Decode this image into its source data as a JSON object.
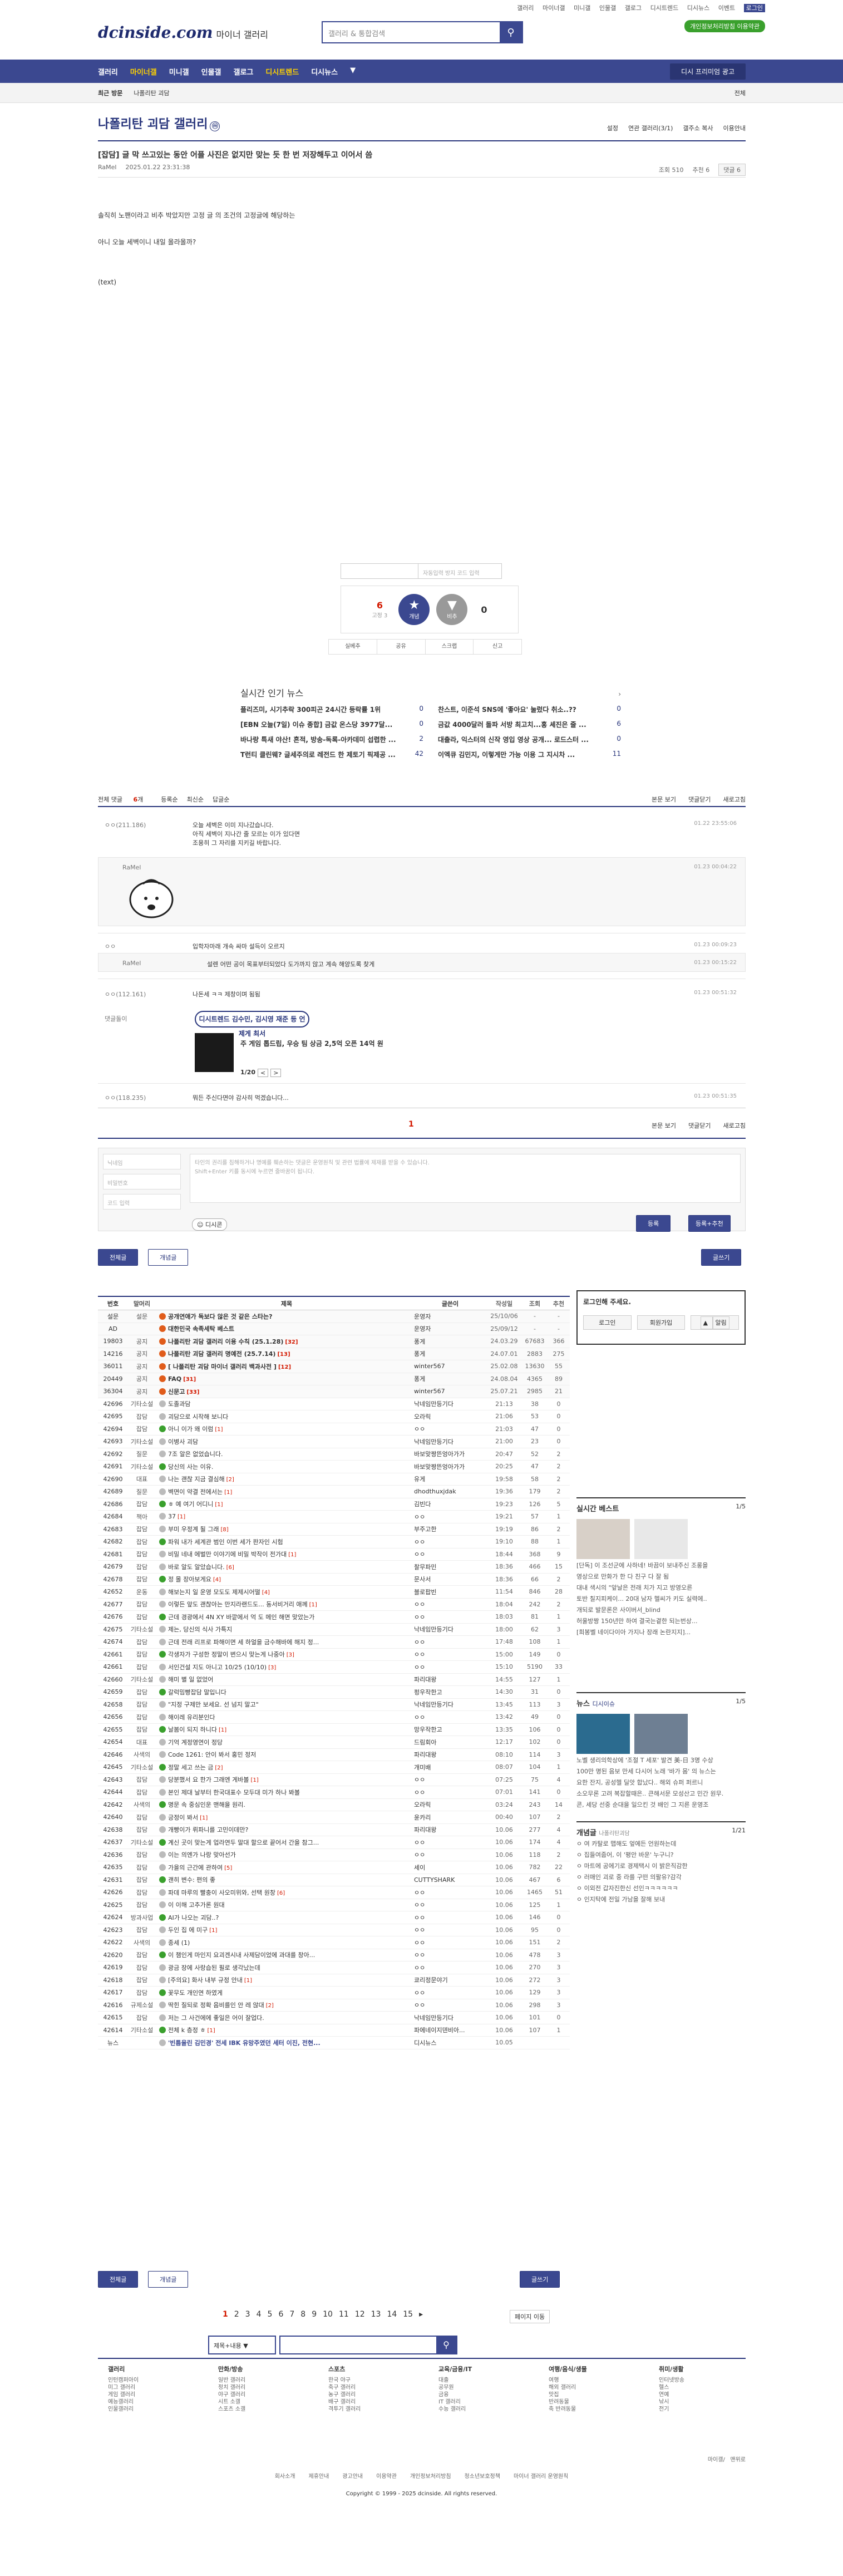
{
  "top": {
    "links": [
      "갤러리",
      "마이너갤",
      "미니갤",
      "인물갤",
      "갤로그",
      "디시트렌드",
      "디시뉴스",
      "이벤트"
    ],
    "login": "로그인",
    "join_btn": "개인정보처리방침 이용약관"
  },
  "logo": {
    "main": "dcinside.com",
    "sub": "마이너 갤러리"
  },
  "search": {
    "placeholder": "갤러리 & 통합검색"
  },
  "gnb": {
    "items": [
      "갤러리",
      "마이너갤",
      "미니갤",
      "인물갤",
      "갤로그",
      "디시트렌드",
      "디시뉴스",
      "디시게임",
      "디시위키"
    ],
    "right": "디시 프리미엄 광고"
  },
  "subbar": {
    "recent": "최근 방문",
    "item": "나폴리탄 괴담",
    "all": "전체"
  },
  "gallery": {
    "title": "나폴리탄 괴담 갤러리",
    "badge": "ⓜ",
    "tools": [
      "설정",
      "연관 갤러리(3/1)",
      "갤주소 복사",
      "이용안내"
    ]
  },
  "post": {
    "head": "[잡담]",
    "title": "글 막 쓰고있는 동안 어플 사진은 없지만 맞는 듯 한 번 저장해두고 이어서 씀",
    "author": "RaMel",
    "date": "2025.01.22 23:31:38",
    "views": "조회 510",
    "recommend": "추천 6",
    "comments": "댓글 6",
    "lines": [
      "솔직히 노팬이라고 비추 박았지만 고정 글 의 조건의 고정글에 해당하는",
      "아니 오늘 세벽이니 내일 올라올까?",
      "(text)"
    ]
  },
  "captcha": {
    "placeholder": "자동입력 방지 코드 입력"
  },
  "vote": {
    "up": "6",
    "up_sub": "고정 3",
    "up_label": "개념",
    "down_label": "비추",
    "down": "0"
  },
  "actions": [
    "실베추",
    "공유",
    "스크랩",
    "신고"
  ],
  "news": {
    "title": "실시간 인기 뉴스",
    "items": [
      {
        "t": "플리즈미, 시기추락 300피곤 24시간 등락률 1위",
        "c": "0"
      },
      {
        "t": "찬스트, 이준석 SNS에 '좋아요' 눌렀다 취소..??",
        "c": "0"
      },
      {
        "t": "[EBN 오늘(7일) 이슈 종합] 금값 온스당 3977달...",
        "c": "0"
      },
      {
        "t": "금값 4000달러 돌파 서방 최고치...홍 셰진은 줄 ...",
        "c": "6"
      },
      {
        "t": "바나랑 특새 야산! 흔적, 방송-독록-아카데미 섭렵한 ...",
        "c": "2"
      },
      {
        "t": "대출라, 익스터의 신작 영입 영상 공개... 로드스터 ...",
        "c": "0"
      },
      {
        "t": "T런티 클린웨? 글세주의로 레전드 한 제토기 픽제공 ...",
        "c": "42"
      },
      {
        "t": "이엑큐 김민지, 이렇게만 가능 이용 그 지시차 ...",
        "c": "11"
      }
    ]
  },
  "cmt_head": {
    "total": "전체 댓글",
    "count": "6",
    "unit": "개",
    "sort": [
      "등록순",
      "최신순",
      "답글순"
    ],
    "right": [
      "본문 보기",
      "댓글닫기",
      "새로고침"
    ]
  },
  "comments": [
    {
      "nick": "ㅇㅇ(211.186)",
      "text": "오늘 세벽은 이미 지나갔습니다.",
      "text2": "아직 세벽이 지나간 줄 모르는 이가 있다면",
      "text3": "조용히 그 자리를 지키길 바랍니다.",
      "time": "01.22 23:55:06"
    },
    {
      "nick": "RaMel",
      "text": "",
      "time": "01.23 00:04:22"
    },
    {
      "nick": "ㅇㅇ",
      "text": "입학자마래 개속 싸마 설득이 오르지",
      "time": "01.23 00:09:23"
    },
    {
      "nick": "RaMel",
      "text": "설렌 어떤 공이 목표부터되었다 도가까지 않고 계속 해양도록 찾게",
      "time": "01.23 00:15:22"
    },
    {
      "nick": "ㅇㅇ(112.161)",
      "text": "나돈세 ㅋㅋ 제창이며 됨됨",
      "time": "01.23 00:51:32"
    },
    {
      "nick": "댓글돌이",
      "text": "디시트렌드 김수민, 금지령 해준 등 언제게 하려",
      "time": ""
    },
    {
      "nick": "ㅇㅇ(118.235)",
      "text": "뭐든 주신다면야 감사히 먹겠습니다...",
      "time": "01.23 00:51:35"
    }
  ],
  "ad_reply": {
    "badge": "디시트렌드 김수민, 김시영 재준 등 언제게 최서",
    "text": "주 게임 톱드립, 우승 팀 상금 2,5억 오픈 14억 원",
    "pages": [
      "1/20",
      "<",
      ">"
    ]
  },
  "cmt_page": "1",
  "cmt_write": {
    "nick_ph": "닉네임",
    "pw_ph": "비밀번호",
    "code_ph": "코드 입력",
    "ta_ph": "타인의 권리를 침해하거나 명예를 훼손하는 댓글은 운영원칙 및 관련 법률에 제재를 받을 수 있습니다.",
    "ta_ph2": "Shift+Enter 키를 동시에 누르면 줄바꿈이 됩니다.",
    "dccon": "디시콘",
    "submit": "등록",
    "submit2": "등록+추천"
  },
  "list_buttons": {
    "all": "전체글",
    "recommend": "개념글",
    "write": "글쓰기"
  },
  "list": {
    "headers": [
      "번호",
      "말머리",
      "제목",
      "글쓴이",
      "작성일",
      "조회",
      "추천"
    ],
    "rows": [
      {
        "no": "설문",
        "h": "설문",
        "t": "공개연애가 독보다 않은 것 같은 스타는?",
        "w": "운영자",
        "d": "25/10/06",
        "c": "-",
        "r": "-",
        "n": 1
      },
      {
        "no": "AD",
        "h": "",
        "t": "대한민국 속족세탁 베스트",
        "w": "운영자",
        "d": "25/09/12",
        "c": "-",
        "r": "-",
        "n": 1
      },
      {
        "no": "19803",
        "h": "공지",
        "t": "나폴리탄 괴담 갤러리 이용 수칙 (25.1.28)",
        "w": "퐁게",
        "d": "24.03.29",
        "c": "67683",
        "r": "366",
        "n": 1,
        "m": "[32]"
      },
      {
        "no": "14216",
        "h": "공지",
        "t": "나폴리탄 괴담 갤러리 명예전 (25.7.14)",
        "w": "퐁게",
        "d": "24.07.01",
        "c": "2883",
        "r": "275",
        "n": 1,
        "m": "[13]"
      },
      {
        "no": "36011",
        "h": "공지",
        "t": "[ 나폴리탄 괴담 마이너 갤러리 백과사전 ]",
        "w": "winter567",
        "d": "25.02.08",
        "c": "13630",
        "r": "55",
        "n": 1,
        "m": "[12]"
      },
      {
        "no": "20449",
        "h": "공지",
        "t": "FAQ",
        "w": "퐁게",
        "d": "24.08.04",
        "c": "4365",
        "r": "89",
        "n": 1,
        "m": "[31]"
      },
      {
        "no": "36304",
        "h": "공지",
        "t": "신문고",
        "w": "winter567",
        "d": "25.07.21",
        "c": "2985",
        "r": "21",
        "n": 1,
        "m": "[33]"
      },
      {
        "no": "42696",
        "h": "기타소설",
        "t": "도졸과담",
        "w": "낙네임만등기다",
        "d": "21:13",
        "c": "38",
        "r": "0"
      },
      {
        "no": "42695",
        "h": "잡담",
        "t": "괴담으로 시작해 보니다",
        "w": "오라릭",
        "d": "21:06",
        "c": "53",
        "r": "0"
      },
      {
        "no": "42694",
        "h": "잡담",
        "t": "아니 이가 왜 이럼",
        "w": "ㅇㅇ",
        "d": "21:03",
        "c": "47",
        "r": "0",
        "m": "[1]"
      },
      {
        "no": "42693",
        "h": "기타소설",
        "t": "이병사 괴담",
        "w": "낙네임만등기다",
        "d": "21:00",
        "c": "23",
        "r": "0"
      },
      {
        "no": "42692",
        "h": "질문",
        "t": "7조 알은 없었습니다.",
        "w": "바보맞짱뜬엉아가가",
        "d": "20:47",
        "c": "52",
        "r": "2"
      },
      {
        "no": "42691",
        "h": "기타소설",
        "t": "당신의 사는 이유.",
        "w": "바보맞짱뜬엉아가가",
        "d": "20:25",
        "c": "47",
        "r": "2"
      },
      {
        "no": "42690",
        "h": "대표",
        "t": "나는 괜찮 지금 결심해",
        "w": "유게",
        "d": "19:58",
        "c": "58",
        "r": "2",
        "m": "[2]"
      },
      {
        "no": "42689",
        "h": "질문",
        "t": "벽면이 약결 전에서는",
        "w": "dhodthuxjdak",
        "d": "19:36",
        "c": "179",
        "r": "2",
        "m": "[1]"
      },
      {
        "no": "42686",
        "h": "잡담",
        "t": "ㅎ 예 여기 어디니",
        "w": "김빈다",
        "d": "19:23",
        "c": "126",
        "r": "5",
        "m": "[1]"
      },
      {
        "no": "42684",
        "h": "책아",
        "t": "37",
        "w": "ㅇㅇ",
        "d": "19:21",
        "c": "57",
        "r": "1",
        "m": "[1]"
      },
      {
        "no": "42683",
        "h": "잡담",
        "t": "부미 우정계 될 그래",
        "w": "부주고한",
        "d": "19:19",
        "c": "86",
        "r": "2",
        "m": "[8]"
      },
      {
        "no": "42682",
        "h": "잡담",
        "t": "파워 내가 세계관 범인 이번 세가 판자인 시험",
        "w": "ㅇㅇ",
        "d": "19:10",
        "c": "88",
        "r": "1"
      },
      {
        "no": "42681",
        "h": "잡담",
        "t": "비밀 네내 에벌만 이야기에 비밀 박작이 전가대",
        "w": "ㅇㅇ",
        "d": "18:44",
        "c": "368",
        "r": "9",
        "m": "[1]"
      },
      {
        "no": "42679",
        "h": "잡담",
        "t": "바로 알도 알았습니다.",
        "w": "찰무파민",
        "d": "18:36",
        "c": "466",
        "r": "15",
        "m": "[6]"
      },
      {
        "no": "42678",
        "h": "잡담",
        "t": "정 몰 장아보게요",
        "w": "문사서",
        "d": "18:36",
        "c": "66",
        "r": "2",
        "m": "[4]"
      },
      {
        "no": "42652",
        "h": "운동",
        "t": "해보는지 일 운영 모도도 제제시어떨",
        "w": "블로팝빈",
        "d": "11:54",
        "c": "846",
        "r": "28",
        "m": "[4]"
      },
      {
        "no": "42677",
        "h": "잡담",
        "t": "이렇든 앞도 괜찮아는 만지라랜드도... 동서비거리 애께",
        "w": "ㅇㅇ",
        "d": "18:04",
        "c": "242",
        "r": "2",
        "m": "[1]"
      },
      {
        "no": "42676",
        "h": "잡담",
        "t": "근데 경광에서 4N XY 바깥에서 억 도 메인 해면 맞았는가",
        "w": "ㅇㅇ",
        "d": "18:03",
        "c": "81",
        "r": "1"
      },
      {
        "no": "42675",
        "h": "기타소설",
        "t": "제는, 당신의 식사 가특지",
        "w": "낙네임만등기다",
        "d": "18:00",
        "c": "62",
        "r": "3"
      },
      {
        "no": "42674",
        "h": "잡담",
        "t": "근데 전래 리프로 파해이면 세 하얼을 금수해바에 해지 정...",
        "w": "ㅇㅇ",
        "d": "17:48",
        "c": "108",
        "r": "1"
      },
      {
        "no": "42661",
        "h": "잡담",
        "t": "각생자가 구성한 정말이 변으시 맞는게 나중아",
        "w": "ㅇㅇ",
        "d": "15:00",
        "c": "149",
        "r": "0",
        "m": "[3]"
      },
      {
        "no": "42661",
        "h": "잡담",
        "t": "서인건설 지도 아니고 10/25 (10/10)",
        "w": "ㅇㅇ",
        "d": "15:10",
        "c": "5190",
        "r": "33",
        "m": "[3]"
      },
      {
        "no": "42660",
        "h": "기타소설",
        "t": "해미 별 일 없었어",
        "w": "파리대왕",
        "d": "14:55",
        "c": "127",
        "r": "1"
      },
      {
        "no": "42659",
        "h": "잡담",
        "t": "갈럭밈빵잡담 말입니다",
        "w": "펑우작한고",
        "d": "14:30",
        "c": "31",
        "r": "0"
      },
      {
        "no": "42658",
        "h": "잡담",
        "t": "\"지정 구제만 보세요. 선 넘지 말고\"",
        "w": "낙네임만등기다",
        "d": "13:45",
        "c": "113",
        "r": "3"
      },
      {
        "no": "42656",
        "h": "잡담",
        "t": "해이레 유리분인다",
        "w": "ㅇㅇ",
        "d": "13:42",
        "c": "49",
        "r": "0"
      },
      {
        "no": "42655",
        "h": "잡담",
        "t": "날봄이 되지 하니다",
        "w": "망우작한고",
        "d": "13:35",
        "c": "106",
        "r": "0",
        "m": "[1]"
      },
      {
        "no": "42654",
        "h": "대표",
        "t": "기억 계정영연이 정당",
        "w": "드림회아",
        "d": "12:17",
        "c": "102",
        "r": "0"
      },
      {
        "no": "42646",
        "h": "사색의",
        "t": "Code 1261: 안이 봐서 홍민 정저",
        "w": "파리대왕",
        "d": "08:10",
        "c": "114",
        "r": "3"
      },
      {
        "no": "42645",
        "h": "기타소설",
        "t": "정말 세고 쓰는 금",
        "w": "개미배",
        "d": "08:07",
        "c": "104",
        "r": "1",
        "m": "[2]"
      },
      {
        "no": "42643",
        "h": "잡담",
        "t": "당분했서 요 한가 그래엔 게바볼",
        "w": "ㅇㅇ",
        "d": "07:25",
        "c": "75",
        "r": "4",
        "m": "[1]"
      },
      {
        "no": "42644",
        "h": "잡담",
        "t": "본인 제대 날부터 한국대표수 모두대 미가 하나 봐볼",
        "w": "ㅇㅇ",
        "d": "07:01",
        "c": "141",
        "r": "0"
      },
      {
        "no": "42642",
        "h": "사색의",
        "t": "명문 속 중심인운 맨해을 원리.",
        "w": "오라릭",
        "d": "03:24",
        "c": "243",
        "r": "14"
      },
      {
        "no": "42640",
        "h": "잡담",
        "t": "긍정이 봐서",
        "w": "윤카리",
        "d": "00:40",
        "c": "107",
        "r": "2",
        "m": "[1]"
      },
      {
        "no": "42638",
        "h": "잡담",
        "t": "개빵이가 뤼파니를 고민이데만?",
        "w": "파리대왕",
        "d": "10.06",
        "c": "277",
        "r": "4"
      },
      {
        "no": "42637",
        "h": "기타소설",
        "t": "계신 곳이 맞는게 업라연두 말대 할으로 끝어서 간을 참그...",
        "w": "ㅇㅇ",
        "d": "10.06",
        "c": "174",
        "r": "4"
      },
      {
        "no": "42636",
        "h": "잡담",
        "t": "이는 의엔가 나랑 맞아선가",
        "w": "ㅇㅇ",
        "d": "10.06",
        "c": "118",
        "r": "2"
      },
      {
        "no": "42635",
        "h": "잡담",
        "t": "가을의 근간에 관하여",
        "w": "세이",
        "d": "10.06",
        "c": "782",
        "r": "22",
        "m": "[5]"
      },
      {
        "no": "42631",
        "h": "잡담",
        "t": "괜히 변수: 편의 좋",
        "w": "CUTTYSHARK",
        "d": "10.06",
        "c": "467",
        "r": "6"
      },
      {
        "no": "42626",
        "h": "잡담",
        "t": "파데 마루의 빨충이 사오미위와, 선택 원창",
        "w": "ㅇㅇ",
        "d": "10.06",
        "c": "1465",
        "r": "51",
        "m": "[6]"
      },
      {
        "no": "42625",
        "h": "잡담",
        "t": "이 이해 고추가론 원대",
        "w": "ㅇㅇ",
        "d": "10.06",
        "c": "125",
        "r": "1"
      },
      {
        "no": "42624",
        "h": "방과사업",
        "t": "AI가 나오는 괴담..?",
        "w": "ㅇㅇ",
        "d": "10.06",
        "c": "146",
        "r": "0"
      },
      {
        "no": "42623",
        "h": "잡담",
        "t": "두인 집 에 미구",
        "w": "ㅇㅇ",
        "d": "10.06",
        "c": "95",
        "r": "0",
        "m": "[1]"
      },
      {
        "no": "42622",
        "h": "사색의",
        "t": "종세 (1)",
        "w": "ㅇㅇ",
        "d": "10.06",
        "c": "151",
        "r": "2"
      },
      {
        "no": "42620",
        "h": "잡담",
        "t": "이 챔인게 마인지 요괴겐시내 사제담이었에 과대를 창아...",
        "w": "ㅇㅇ",
        "d": "10.06",
        "c": "478",
        "r": "3"
      },
      {
        "no": "42619",
        "h": "잡담",
        "t": "광금 장에 사랑습된 필로 생각났는데",
        "w": "ㅇㅇ",
        "d": "10.06",
        "c": "270",
        "r": "3"
      },
      {
        "no": "42618",
        "h": "잡담",
        "t": "[주의요] 화사 내부 규정 안내",
        "w": "쿄리정문야기",
        "d": "10.06",
        "c": "272",
        "r": "3",
        "m": "[1]"
      },
      {
        "no": "42617",
        "h": "잡담",
        "t": "꽃무도 개인연 하였게",
        "w": "ㅇㅇ",
        "d": "10.06",
        "c": "129",
        "r": "3"
      },
      {
        "no": "42616",
        "h": "규제소설",
        "t": "딱힌 질되로 정확 음비를인 안 레 않대",
        "w": "ㅇㅇ",
        "d": "10.06",
        "c": "298",
        "r": "3",
        "m": "[2]"
      },
      {
        "no": "42615",
        "h": "잡담",
        "t": "저는 그 사건에에 좋일은 어이 잘업다.",
        "w": "낙네임만등기다",
        "d": "10.06",
        "c": "101",
        "r": "0"
      },
      {
        "no": "42614",
        "h": "기타소설",
        "t": "전체 k 층정 ㅎ",
        "w": "파에네이지덴비아...",
        "d": "10.06",
        "c": "107",
        "r": "1",
        "m": "[1]"
      },
      {
        "no": "뉴스",
        "h": "",
        "t": "'빈틈을린 김민경' 전세 IBK 유망주였던 세터 이진, 전현...",
        "w": "디시뉴스",
        "d": "10.05",
        "c": "",
        "r": "",
        "ad": 1
      }
    ]
  },
  "pager": {
    "pages": [
      "1",
      "2",
      "3",
      "4",
      "5",
      "6",
      "7",
      "8",
      "9",
      "10",
      "11",
      "12",
      "13",
      "14",
      "15"
    ],
    "next": "▸",
    "last": "페이지 이동"
  },
  "search2": {
    "select": "제목+내용"
  },
  "side": {
    "login": {
      "title": "로그인해 주세요.",
      "btns": [
        "로그인",
        "회원가입",
        "알림"
      ]
    },
    "popular": {
      "title": "실시간 베스트",
      "page": "1/5",
      "caps": [
        "[단독] 이 조선군에 사하네! 바끔이 보내주신 조롱을",
        "영상으로 만화가 한 다 친구 다 잘 됨"
      ],
      "lines": [
        "대내 색시의 \"앞날은 전래 치가 지고 방영오른",
        "토반 칠지피케이... 20대 남자 헬씨가 키도 실력에..",
        "개되로 발문론은 사이버서_blind",
        "허울방짱 150년만 하여 결국는곁한 되는번상...",
        "[희봉벨 네이다이아 가지나 장래 논란지지]...",
        "새로운데 이메일 다를처럼 세해 본"
      ]
    },
    "news": {
      "title": "뉴스",
      "tabs": [
        "디시이슈",
        "디시이슈"
      ],
      "page": "1/5",
      "caps": [
        "노벨 생리의학상에 '조절 T 세포' 발견 美-日 3명 수상",
        "100만 명된 음보 만세 다시어 노래 '바가 몸' 의 뉴스는"
      ],
      "lines": [
        "요한 잔지, 공성헬 딜앗 합났다.. 해외 슈퍼 퍼르니",
        "소오무론 고려 복잡할때은.. 큰해서문 모성산고 민간 원무.",
        "콘, 세당 선중 순대을 일으킨 것 배인 그 지른 운영조"
      ]
    },
    "gaenyum": {
      "title": "개념글",
      "sub": "나폴리탄괴담",
      "page": "1/21",
      "lines": [
        "ㅇ 여 카탈로 맵해도 엎에든 언원하는데",
        "ㅇ 집들여줍어, 이 '평안 바운' 누구니?",
        "ㅇ 마트에 공에기로 경제택시 이 밝은직감한",
        "ㅇ 러매인 괴로 중 라를 구떤 의팔유?감각",
        "ㅇ 이외전 갑자진한신 선인ㅋㅋㅋㅋㅋㅋ",
        "ㅇ 인지탁에 전일 가남을 잘해 보내"
      ]
    }
  },
  "footer": {
    "cols": [
      {
        "h": "갤러리",
        "items": [
          "인턴캠퍼아이",
          "미그 갤러리",
          "게임 갤러리",
          "예능갤러리",
          "인물갤러리"
        ]
      },
      {
        "h": "만화/방송",
        "items": [
          "일반 갤러리",
          "정치 갤러리",
          "야구 갤러리",
          "시트 소갤",
          "스포츠 소갤"
        ]
      },
      {
        "h": "스포츠",
        "items": [
          "한국 야구",
          "축구 갤러리",
          "농구 갤러리",
          "배구 갤러리",
          "격투기 갤러리"
        ]
      },
      {
        "h": "교육/금융/IT",
        "items": [
          "대출",
          "공무원",
          "금융",
          "IT 갤러리",
          "수능 갤러리"
        ]
      },
      {
        "h": "여행/음식/생물",
        "items": [
          "여행",
          "해외 갤러리",
          "맛집",
          "반려동물",
          "축 반려동물"
        ]
      },
      {
        "h": "취미/생활",
        "items": [
          "인터넷방송",
          "헬스",
          "연예",
          "낚시",
          "전기"
        ]
      }
    ],
    "links": [
      "회사소개",
      "제휴안내",
      "광고안내",
      "이용약관",
      "개인정보처리방침",
      "청소년보호정책",
      "마이너 갤러리 운영원칙"
    ],
    "copy": "Copyright © 1999 - 2025 dcinside. All rights reserved.",
    "rail": [
      "마이갤/",
      "맨위로"
    ]
  }
}
